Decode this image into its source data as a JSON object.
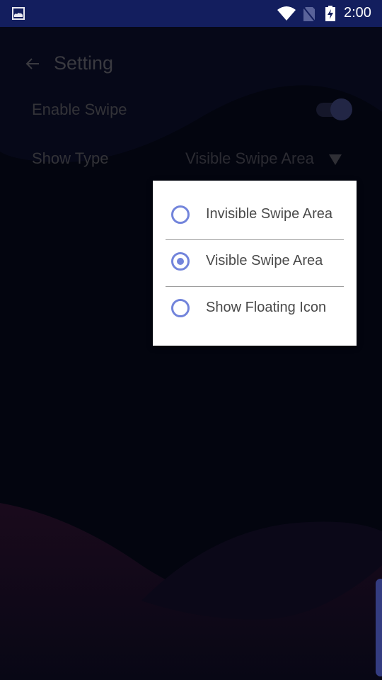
{
  "status_bar": {
    "time": "2:00",
    "icons": [
      "gallery-icon",
      "wifi-icon",
      "no-sim-icon",
      "battery-charging-icon"
    ]
  },
  "app_bar": {
    "back_icon": "arrow-left-icon",
    "title": "Setting"
  },
  "settings": {
    "enable_swipe": {
      "label": "Enable Swipe",
      "enabled": true
    },
    "show_type": {
      "label": "Show Type",
      "value": "Visible Swipe Area",
      "dropdown_icon": "triangle-down-icon"
    }
  },
  "show_type_menu": {
    "options": [
      {
        "label": "Invisible Swipe Area",
        "selected": false
      },
      {
        "label": "Visible Swipe Area",
        "selected": true
      },
      {
        "label": "Show Floating Icon",
        "selected": false
      }
    ]
  },
  "colors": {
    "status_bar": "#131e5e",
    "background": "#03050f",
    "radio_accent": "#7284db",
    "edge_tab": "#343c80"
  }
}
